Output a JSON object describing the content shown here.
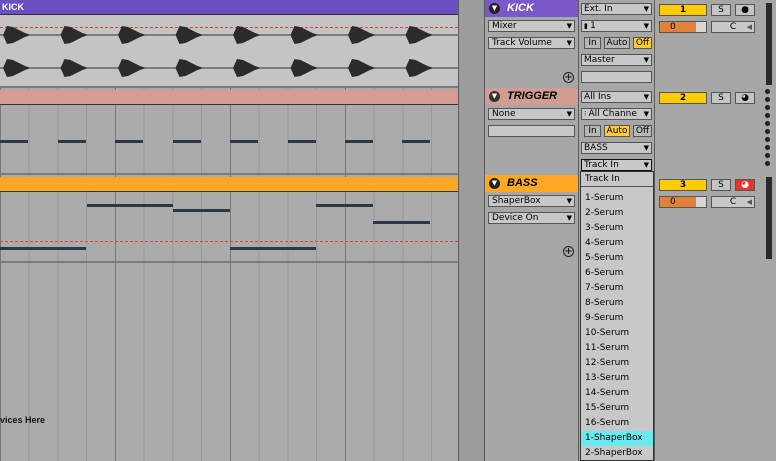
{
  "tracks": [
    {
      "clip_name": "KICK",
      "clip_color": "#6a4fc0",
      "device_title": "KICK",
      "title_color": "#7b58c8",
      "chooser_1": "Mixer",
      "chooser_2": "Track Volume",
      "input_type": "Ext. In",
      "input_channel": "1",
      "monitor": [
        "In",
        "Auto",
        "Off"
      ],
      "monitor_active": "Off",
      "output_type": "Master",
      "output_channel": "",
      "track_number": "1",
      "solo": "S",
      "arm_icon": "record-dot-icon",
      "volume": "0",
      "pan": "C"
    },
    {
      "clip_name": "TRIGGER",
      "clip_color": "#d69d93",
      "device_title": "TRIGGER",
      "title_color": "#d29c90",
      "chooser_1": "None",
      "input_type": "All Ins",
      "input_channel": "All Channe",
      "monitor": [
        "In",
        "Auto",
        "Off"
      ],
      "monitor_active": "Auto",
      "output_type": "BASS",
      "output_channel": "Track In",
      "track_number": "2",
      "solo": "S",
      "arm_icon": "record-midi-icon"
    },
    {
      "clip_name": "",
      "clip_color": "#ffa826",
      "device_title": "BASS",
      "title_color": "#ffa826",
      "chooser_1": "ShaperBox",
      "chooser_2": "Device On",
      "track_number": "3",
      "solo": "S",
      "arm_icon": "record-armed-icon",
      "volume": "0",
      "pan": "C"
    }
  ],
  "drop_hint": "vices Here",
  "output_channel_menu": {
    "items": [
      "Track In",
      "1-Serum",
      "2-Serum",
      "3-Serum",
      "4-Serum",
      "5-Serum",
      "6-Serum",
      "7-Serum",
      "8-Serum",
      "9-Serum",
      "10-Serum",
      "11-Serum",
      "12-Serum",
      "13-Serum",
      "14-Serum",
      "15-Serum",
      "16-Serum",
      "1-ShaperBox",
      "2-ShaperBox"
    ],
    "highlighted": "1-ShaperBox"
  }
}
